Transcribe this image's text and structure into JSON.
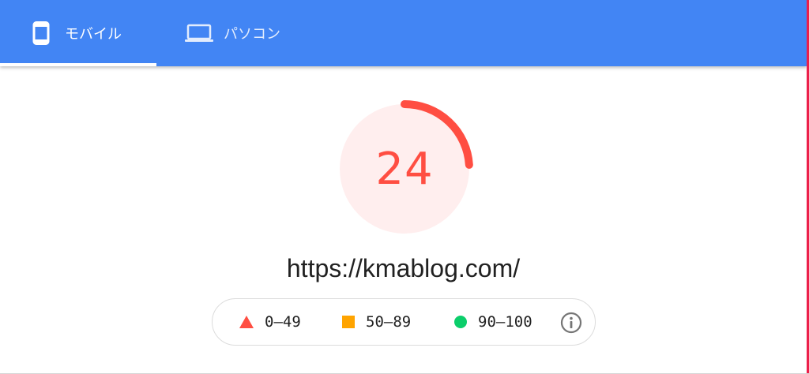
{
  "tabs": [
    {
      "id": "mobile",
      "label": "モバイル",
      "icon": "phone-icon",
      "selected": true
    },
    {
      "id": "desktop",
      "label": "パソコン",
      "icon": "laptop-icon",
      "selected": false
    }
  ],
  "score": {
    "value": "24",
    "fraction": 0.24,
    "color": "#ff4e42",
    "background": "#ffeeee"
  },
  "url": "https://kmablog.com/",
  "legend": {
    "items": [
      {
        "label": "0–49",
        "shape": "triangle-icon",
        "color": "#ff4e42"
      },
      {
        "label": "50–89",
        "shape": "square-icon",
        "color": "#ffa400"
      },
      {
        "label": "90–100",
        "shape": "circle-icon",
        "color": "#0cce6b"
      }
    ],
    "info_icon": "info-icon"
  },
  "colors": {
    "header": "#4285f4",
    "text": "#212121"
  }
}
